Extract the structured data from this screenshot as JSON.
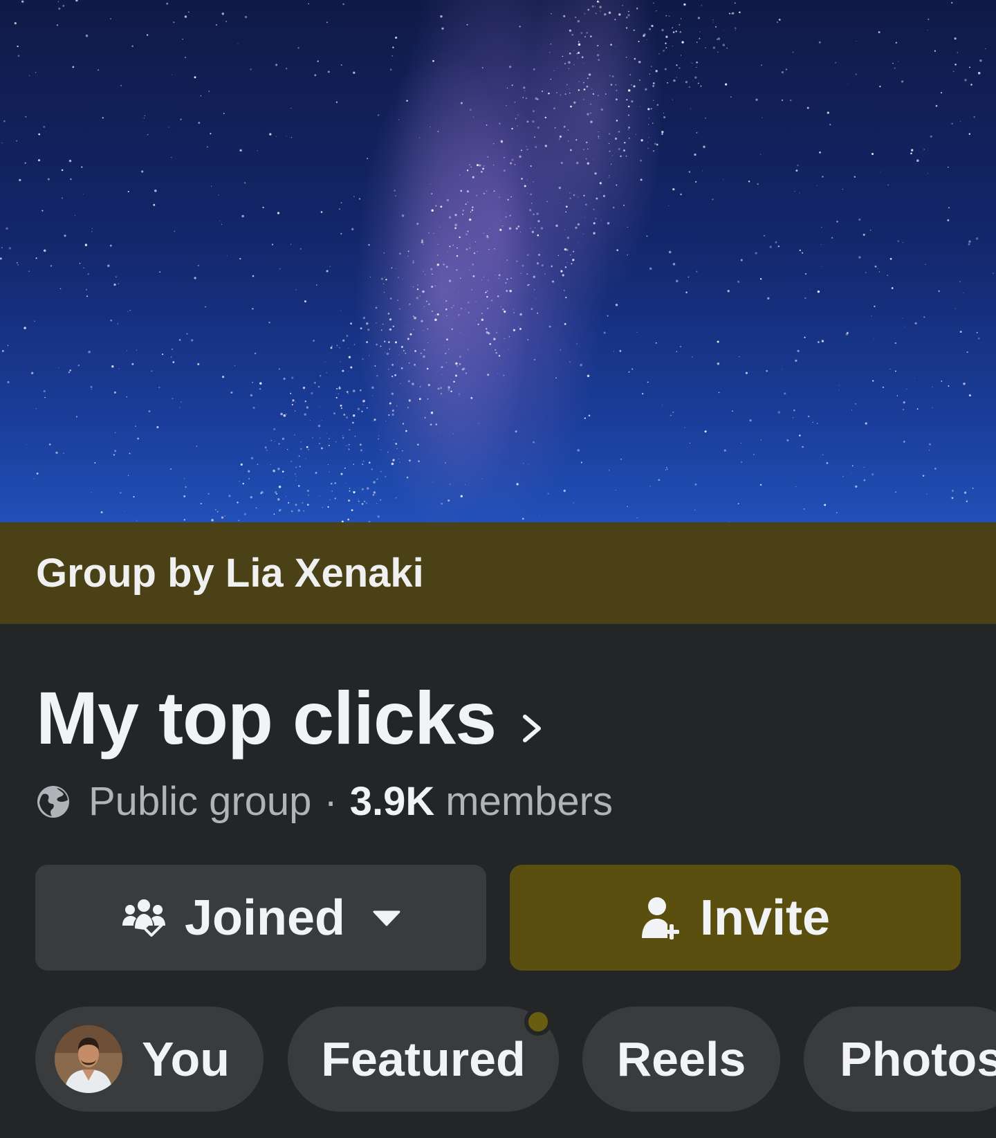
{
  "group": {
    "owner_label": "Group by Lia Xenaki",
    "name": "My top clicks",
    "privacy": "Public group",
    "separator": "·",
    "member_count": "3.9K",
    "member_label": "members"
  },
  "actions": {
    "joined_label": "Joined",
    "invite_label": "Invite"
  },
  "tabs": [
    {
      "label": "You"
    },
    {
      "label": "Featured",
      "has_notification_dot": true
    },
    {
      "label": "Reels"
    },
    {
      "label": "Photos"
    }
  ],
  "colors": {
    "background": "#242526",
    "owner_bar": "#4a4216",
    "invite_button": "#5a4f0e",
    "secondary_button": "#3a3b3c",
    "notification_dot": "#6b5d10"
  },
  "icons": {
    "globe": "globe-icon",
    "chevron": "chevron-right-icon",
    "joined": "group-check-icon",
    "caret": "caret-down-icon",
    "invite": "person-add-icon"
  }
}
